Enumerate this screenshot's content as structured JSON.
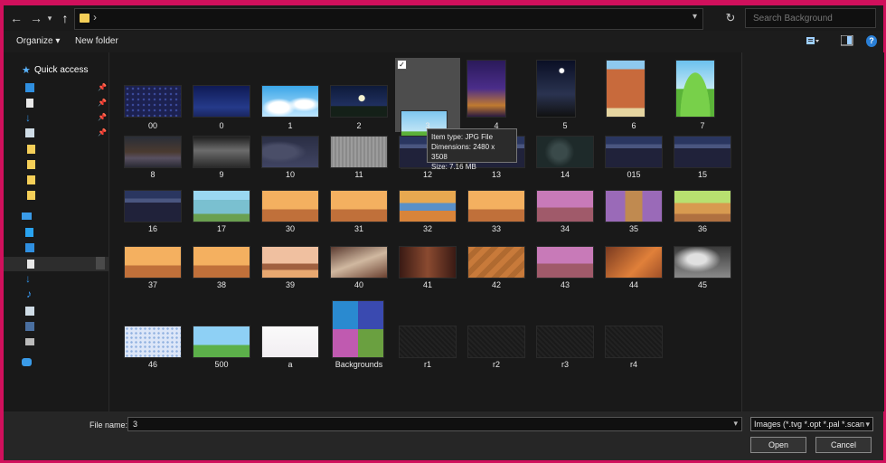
{
  "search": {
    "placeholder": "Search Background"
  },
  "toolbar": {
    "organize_label": "Organize ▾",
    "new_folder_label": "New folder"
  },
  "nav": {
    "quick_access_label": "Quick access"
  },
  "files": [
    {
      "label": "00",
      "thumb": "stars-dark"
    },
    {
      "label": "0",
      "thumb": "night-dark-blue"
    },
    {
      "label": "1",
      "thumb": "sky-clouds"
    },
    {
      "label": "2",
      "thumb": "night-moon-tree"
    },
    {
      "label": "3",
      "thumb": "grass-field"
    },
    {
      "label": "4",
      "thumb": "night-city-purple"
    },
    {
      "label": "5",
      "thumb": "night-moon-building"
    },
    {
      "label": "6",
      "thumb": "brick-tower"
    },
    {
      "label": "7",
      "thumb": "green-hill"
    },
    {
      "label": "8",
      "thumb": "dark-city-street"
    },
    {
      "label": "9",
      "thumb": "gray-fog"
    },
    {
      "label": "10",
      "thumb": "dark-clouds"
    },
    {
      "label": "11",
      "thumb": "gray-texture"
    },
    {
      "label": "12",
      "thumb": "night-street"
    },
    {
      "label": "13",
      "thumb": "night-street"
    },
    {
      "label": "14",
      "thumb": "dark-map"
    },
    {
      "label": "015",
      "thumb": "night-street"
    },
    {
      "label": "15",
      "thumb": "night-street"
    },
    {
      "label": "16",
      "thumb": "night-street"
    },
    {
      "label": "17",
      "thumb": "city-day"
    },
    {
      "label": "30",
      "thumb": "room-orange"
    },
    {
      "label": "31",
      "thumb": "room-orange"
    },
    {
      "label": "32",
      "thumb": "room-bed"
    },
    {
      "label": "33",
      "thumb": "room-orange"
    },
    {
      "label": "34",
      "thumb": "room-purple"
    },
    {
      "label": "35",
      "thumb": "room-purple-door"
    },
    {
      "label": "36",
      "thumb": "kitchen"
    },
    {
      "label": "37",
      "thumb": "room-orange"
    },
    {
      "label": "38",
      "thumb": "room-orange"
    },
    {
      "label": "39",
      "thumb": "sunset-dome"
    },
    {
      "label": "40",
      "thumb": "messy-room"
    },
    {
      "label": "41",
      "thumb": "dark-wood-room"
    },
    {
      "label": "42",
      "thumb": "wood-floor"
    },
    {
      "label": "43",
      "thumb": "room-purple"
    },
    {
      "label": "44",
      "thumb": "wood-floor-orange"
    },
    {
      "label": "45",
      "thumb": "gray-smoke"
    },
    {
      "label": "46",
      "thumb": "blue-pattern-wall"
    },
    {
      "label": "500",
      "thumb": "town-hall"
    },
    {
      "label": "a",
      "thumb": "sketch"
    },
    {
      "label": "Backgrounds",
      "thumb": "collage"
    },
    {
      "label": "r1",
      "thumb": "black-noise"
    },
    {
      "label": "r2",
      "thumb": "black-noise"
    },
    {
      "label": "r3",
      "thumb": "black-noise"
    },
    {
      "label": "r4",
      "thumb": "black-noise"
    }
  ],
  "tooltip": {
    "item_type": "Item type: JPG File",
    "dimensions": "Dimensions: 2480 x 3508",
    "size": "Size: 7.16 MB"
  },
  "bottom": {
    "file_name_label": "File name:",
    "file_name_value": "3",
    "file_type": "Images (*.tvg *.opt *.pal *.scan",
    "open_label": "Open",
    "cancel_label": "Cancel"
  },
  "colors": {
    "frame": "#d0105c",
    "folder": "#f5cf58",
    "accent": "#59b4ff"
  }
}
